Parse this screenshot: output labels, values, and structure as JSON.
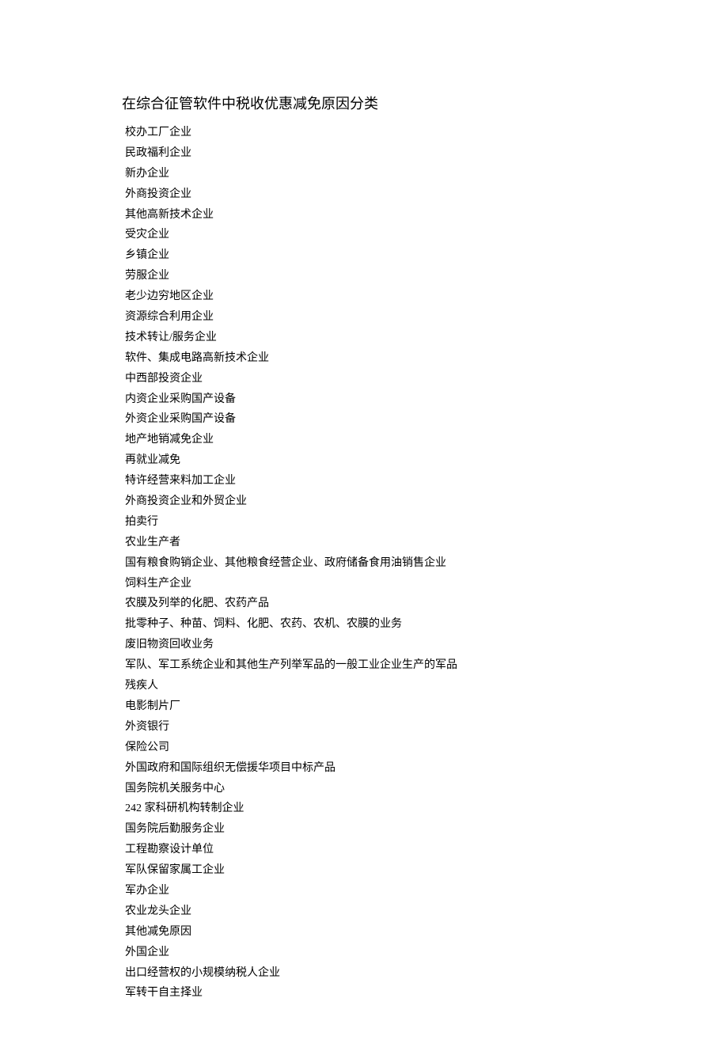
{
  "title": "在综合征管软件中税收优惠减免原因分类",
  "items": [
    "校办工厂企业",
    "民政福利企业",
    "新办企业",
    "外商投资企业",
    "其他高新技术企业",
    "受灾企业",
    "乡镇企业",
    "劳服企业",
    "老少边穷地区企业",
    "资源综合利用企业",
    "技术转让/服务企业",
    "软件、集成电路高新技术企业",
    "中西部投资企业",
    "内资企业采购国产设备",
    "外资企业采购国产设备",
    "地产地销减免企业",
    "再就业减免",
    "特许经营来料加工企业",
    "外商投资企业和外贸企业",
    "拍卖行",
    "农业生产者",
    "国有粮食购销企业、其他粮食经营企业、政府储备食用油销售企业",
    "饲料生产企业",
    "农膜及列举的化肥、农药产品",
    "批零种子、种苗、饲料、化肥、农药、农机、农膜的业务",
    "废旧物资回收业务",
    "军队、军工系统企业和其他生产列举军品的一般工业企业生产的军品",
    "残疾人",
    "电影制片厂",
    "外资银行",
    "保险公司",
    "外国政府和国际组织无偿援华项目中标产品",
    "国务院机关服务中心",
    "242 家科研机构转制企业",
    "国务院后勤服务企业",
    "工程勘察设计单位",
    "军队保留家属工企业",
    "军办企业",
    "农业龙头企业",
    "其他减免原因",
    "外国企业",
    "出口经营权的小规模纳税人企业",
    "军转干自主择业"
  ]
}
